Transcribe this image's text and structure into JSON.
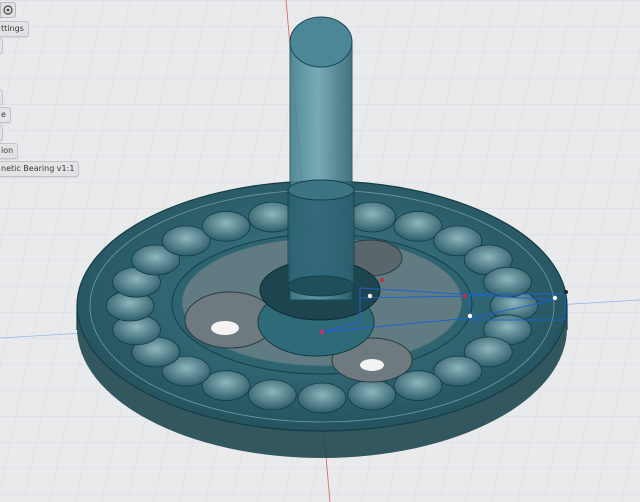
{
  "browser": {
    "settings_icon": "target-icon",
    "items": [
      {
        "label": "ttings"
      },
      {
        "label": ""
      },
      {
        "label": ""
      },
      {
        "label": "e"
      },
      {
        "label": ""
      },
      {
        "label": "ion"
      },
      {
        "label": "netic Bearing v1:1"
      }
    ]
  },
  "colors": {
    "background": "#e9eaec",
    "grid_line": "#d4d6d9",
    "model_fill": "#2f6f7d",
    "model_dark": "#143c45",
    "axis_red": "#e06b6b",
    "sketch_blue": "#2060d0"
  }
}
